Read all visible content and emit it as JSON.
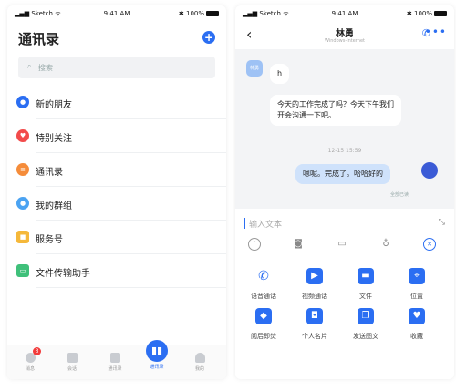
{
  "status": {
    "carrier": "Sketch",
    "time": "9:41 AM",
    "battery": "100%"
  },
  "contacts": {
    "title": "通讯录",
    "add_icon": "plus-icon",
    "search": {
      "placeholder": "搜索"
    },
    "items": [
      {
        "label": "新的朋友",
        "icon": "person-icon",
        "color": "#2b6ef2"
      },
      {
        "label": "特别关注",
        "icon": "heart-icon",
        "color": "#f24b4b"
      },
      {
        "label": "通讯录",
        "icon": "contacts-icon",
        "color": "#f58c3a"
      },
      {
        "label": "我的群组",
        "icon": "group-icon",
        "color": "#4ba3f2"
      },
      {
        "label": "服务号",
        "icon": "service-icon",
        "color": "#f5b83a"
      },
      {
        "label": "文件传输助手",
        "icon": "file-icon",
        "color": "#3fc07a"
      }
    ],
    "tabs": [
      {
        "label": "消息",
        "badge": "3"
      },
      {
        "label": "会话"
      },
      {
        "label": "通讯录"
      },
      {
        "label": "通讯录",
        "active": true
      },
      {
        "label": "我的"
      }
    ]
  },
  "chat": {
    "name": "林勇",
    "subtitle": "Windows-Internet",
    "messages": [
      {
        "from": "them",
        "text": "h"
      },
      {
        "from": "them",
        "text": "今天的工作完成了吗？今天下午我们开会沟通一下吧。"
      },
      {
        "timestamp": "12-15 15:59"
      },
      {
        "from": "me",
        "text": "嗯呢。完成了。哈哈好的",
        "status": "全部已读"
      }
    ],
    "input": {
      "placeholder": "输入文本"
    },
    "actions": [
      {
        "label": "语音通话",
        "icon": "phone-icon"
      },
      {
        "label": "视频通话",
        "icon": "video-icon"
      },
      {
        "label": "文件",
        "icon": "folder-icon"
      },
      {
        "label": "位置",
        "icon": "location-icon"
      },
      {
        "label": "阅后即焚",
        "icon": "burn-icon"
      },
      {
        "label": "个人名片",
        "icon": "card-icon"
      },
      {
        "label": "发送图文",
        "icon": "image-text-icon"
      },
      {
        "label": "收藏",
        "icon": "bookmark-icon"
      }
    ]
  }
}
